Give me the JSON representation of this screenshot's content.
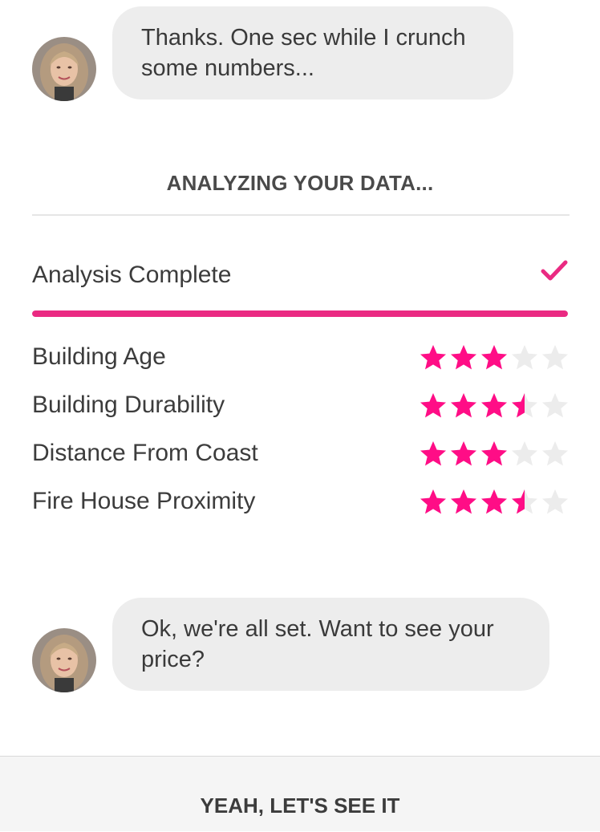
{
  "messages": [
    {
      "text": "Thanks. One sec while I crunch some numbers..."
    },
    {
      "text": "Ok, we're all set. Want to see your price?"
    }
  ],
  "analysis": {
    "heading": "ANALYZING YOUR DATA...",
    "status_label": "Analysis Complete",
    "status_icon": "check-icon",
    "progress": 1.0,
    "accent_color": "#ea2a82",
    "star_color": "#ff0d86",
    "empty_star_color": "#ececec",
    "ratings": [
      {
        "label": "Building Age",
        "stars": 3,
        "max": 5
      },
      {
        "label": "Building Durability",
        "stars": 3.5,
        "max": 5
      },
      {
        "label": "Distance From Coast",
        "stars": 3,
        "max": 5
      },
      {
        "label": "Fire House Proximity",
        "stars": 3.5,
        "max": 5
      }
    ]
  },
  "footer": {
    "button_label": "YEAH, LET'S SEE IT"
  }
}
